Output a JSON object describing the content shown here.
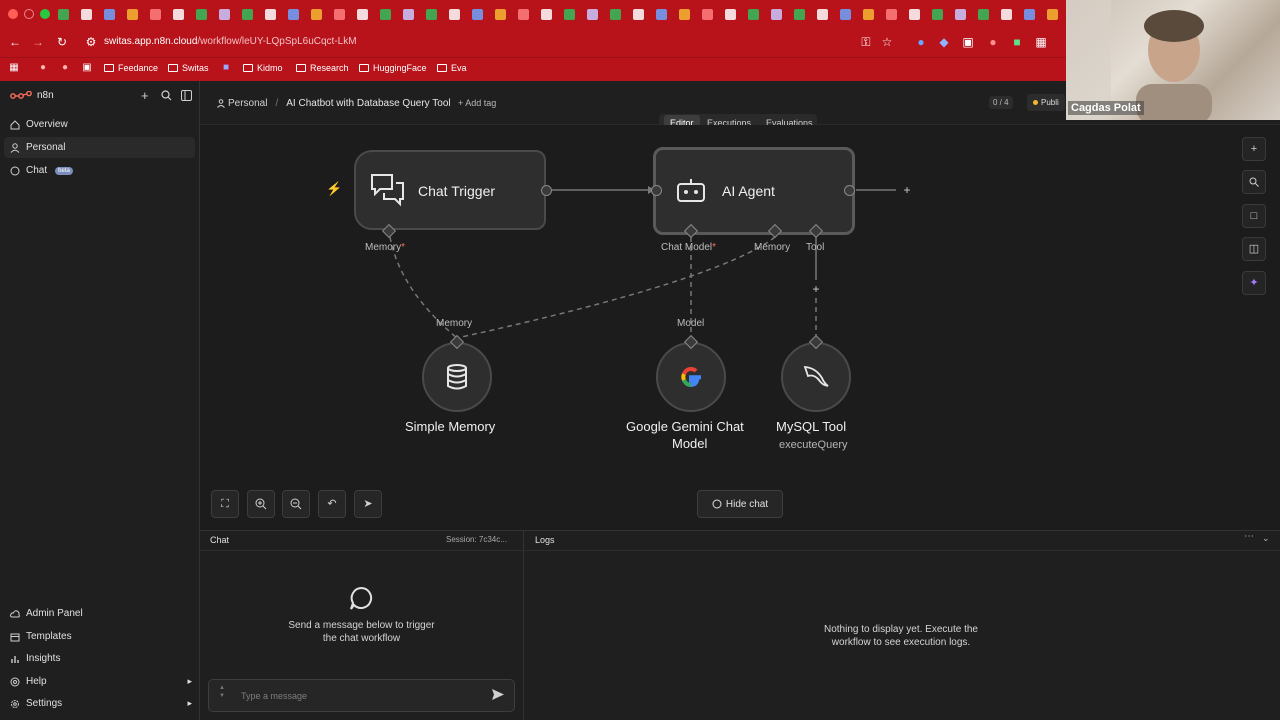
{
  "browser": {
    "url_host": "switas.app.n8n.cloud",
    "url_path": "/workflow/leUY-LQpSpL6uCqct-LkM",
    "bookmarks": [
      "Feedance",
      "Switas",
      "Kidmo",
      "Research",
      "HuggingFace",
      "Eva"
    ]
  },
  "app": {
    "name": "n8n"
  },
  "sidebar": {
    "items": [
      {
        "label": "Overview",
        "icon": "home-icon"
      },
      {
        "label": "Personal",
        "icon": "user-icon"
      },
      {
        "label": "Chat",
        "icon": "chat-icon",
        "badge": "beta"
      }
    ],
    "bottom_items": [
      {
        "label": "Admin Panel",
        "icon": "cloud-icon"
      },
      {
        "label": "Templates",
        "icon": "box-icon"
      },
      {
        "label": "Insights",
        "icon": "chart-icon"
      },
      {
        "label": "Help",
        "icon": "help-icon"
      },
      {
        "label": "Settings",
        "icon": "settings-icon"
      }
    ]
  },
  "header": {
    "breadcrumb_project": "Personal",
    "separator": "/",
    "workflow_name": "AI Chatbot with Database Query Tool",
    "add_tag": "+ Add tag",
    "counter": "0 / 4",
    "publish": "Publi",
    "tabs": [
      "Editor",
      "Executions",
      "Evaluations"
    ],
    "active_tab": "Editor"
  },
  "canvas": {
    "nodes": {
      "chat_trigger": {
        "title": "Chat Trigger",
        "port_label": "Memory",
        "required": "*"
      },
      "ai_agent": {
        "title": "AI Agent",
        "port_chat_model": "Chat Model",
        "required": "*",
        "port_memory": "Memory",
        "port_tool": "Tool"
      },
      "simple_memory": {
        "title": "Simple Memory",
        "port_label": "Memory"
      },
      "gemini": {
        "title_line1": "Google Gemini Chat",
        "title_line2": "Model",
        "port_label": "Model"
      },
      "mysql": {
        "title": "MySQL Tool",
        "subtitle": "executeQuery"
      }
    },
    "hide_chat": "Hide chat"
  },
  "chat_panel": {
    "title": "Chat",
    "session": "Session: 7c34c...",
    "empty_line1": "Send a message below to trigger",
    "empty_line2": "the chat workflow",
    "input_placeholder": "Type a message"
  },
  "logs_panel": {
    "title": "Logs",
    "empty_line1": "Nothing to display yet. Execute the",
    "empty_line2": "workflow to see execution logs."
  },
  "webcam": {
    "name": "Cagdas Polat"
  },
  "colors": {
    "browser_chrome": "#b8121b",
    "accent": "#ff6d5a",
    "canvas_bg": "#1c1c1c"
  }
}
